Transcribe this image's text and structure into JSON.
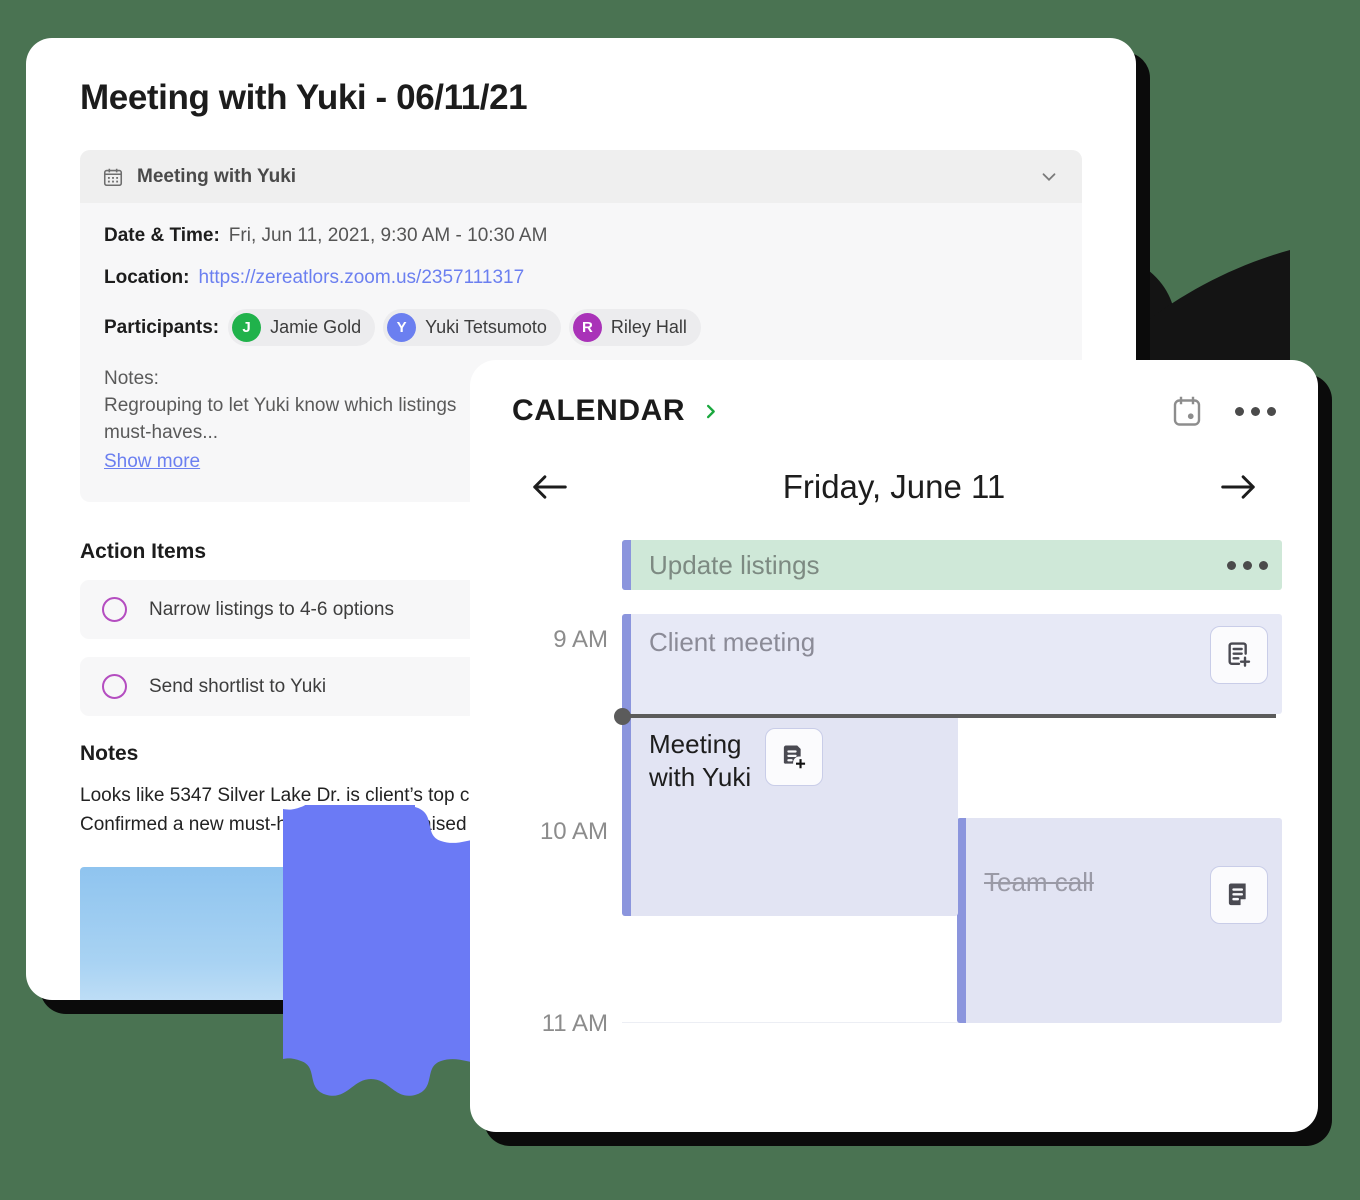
{
  "theme": {
    "background": "#4a7352",
    "blob_color": "#6b7af5",
    "petal_color": "#141414",
    "link_color": "#6b7ff0",
    "accent_purple": "#8b95dd",
    "event_green": "#cfe8d8",
    "event_lavender": "#e2e4f3",
    "checkbox_purple": "#b44dc0",
    "chevron_green": "#1aa83e"
  },
  "notes_card": {
    "page_title": "Meeting with Yuki",
    "page_title_date": " - 06/11/21",
    "event_panel": {
      "icon": "calendar-icon",
      "title": "Meeting with Yuki",
      "collapse_icon": "chevron-down-icon",
      "date_time_label": "Date & Time:",
      "date_time_value": "Fri, Jun 11, 2021, 9:30 AM - 10:30 AM",
      "location_label": "Location:",
      "location_value": "https://zereatlors.zoom.us/2357111317",
      "participants_label": "Participants:",
      "participants": [
        {
          "initial": "J",
          "name": "Jamie Gold",
          "color": "#20b24b"
        },
        {
          "initial": "Y",
          "name": "Yuki Tetsumoto",
          "color": "#6b7ff0"
        },
        {
          "initial": "R",
          "name": "Riley Hall",
          "color": "#a932b8"
        }
      ],
      "notes_label": "Notes:",
      "notes_line_1": "Regrouping to let Yuki know which listings",
      "notes_line_2": "must-haves...",
      "show_more": "Show more"
    },
    "action_items_heading": "Action Items",
    "action_items": [
      {
        "label": "Narrow listings to 4-6 options",
        "checked": false
      },
      {
        "label": "Send shortlist to Yuki",
        "checked": false
      }
    ],
    "notes_heading": "Notes",
    "notes_lines": [
      "Looks like 5347 Silver Lake Dr. is client’s top c",
      "Confirmed a new must-have: Space for raised"
    ],
    "photo_alt": "sky-with-trees-photo"
  },
  "calendar_card": {
    "app_label": "CALENDAR",
    "expand_icon": "chevron-right-icon",
    "calendar_icon": "calendar-day-icon",
    "overflow_icon": "ellipsis-icon",
    "prev_icon": "arrow-left-icon",
    "next_icon": "arrow-right-icon",
    "current_date": "Friday, June 11",
    "hours": [
      "9 AM",
      "10 AM",
      "11 AM"
    ],
    "events": [
      {
        "title": "Update listings",
        "type": "allday",
        "action": "ellipsis-icon"
      },
      {
        "title": "Client meeting",
        "type": "timed",
        "action": "note-add-outline-icon"
      },
      {
        "title": "Meeting\nwith Yuki",
        "title_line_1": "Meeting",
        "title_line_2": "with Yuki",
        "type": "timed",
        "action": "note-add-filled-icon"
      },
      {
        "title": "Team call",
        "type": "timed",
        "cancelled": true,
        "action": "note-filled-icon"
      }
    ]
  }
}
